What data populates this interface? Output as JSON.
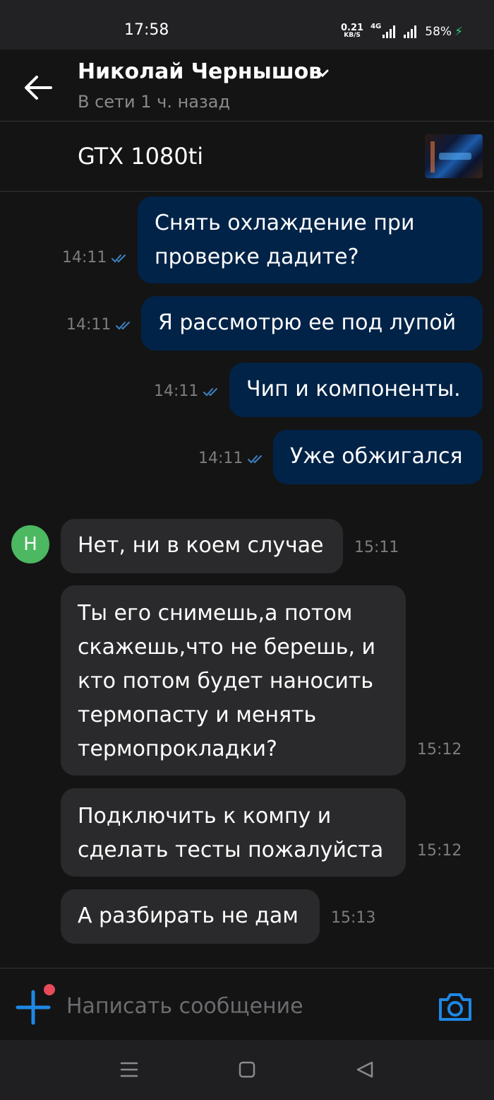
{
  "status_bar": {
    "time": "17:58",
    "speed_value": "0.21",
    "speed_unit": "KB/S",
    "network": "4G",
    "battery": "58%"
  },
  "header": {
    "contact_name": "Николай Чернышов",
    "contact_status": "В сети 1 ч. назад"
  },
  "listing": {
    "title": "GTX 1080ti"
  },
  "messages": [
    {
      "direction": "out",
      "lines": [
        "Снять охлаждение при",
        "проверке дадите?"
      ],
      "time": "14:11",
      "read": true
    },
    {
      "direction": "out",
      "lines": [
        "Я рассмотрю ее под лупой"
      ],
      "time": "14:11",
      "read": true
    },
    {
      "direction": "out",
      "lines": [
        "Чип и компоненты."
      ],
      "time": "14:11",
      "read": true
    },
    {
      "direction": "out",
      "lines": [
        "Уже обжигался"
      ],
      "time": "14:11",
      "read": true
    },
    {
      "direction": "in",
      "lines": [
        "Нет, ни в коем случае"
      ],
      "time": "15:11"
    },
    {
      "direction": "in",
      "lines": [
        "Ты его снимешь,а потом",
        "скажешь,что не берешь, и",
        "кто потом будет наносить",
        "термопасту и менять",
        "термопрокладки?"
      ],
      "time": "15:12"
    },
    {
      "direction": "in",
      "lines": [
        "Подключить к компу и",
        "сделать тесты пожалуйста"
      ],
      "time": "15:12"
    },
    {
      "direction": "in",
      "lines": [
        "А разбирать не дам"
      ],
      "time": "15:13"
    }
  ],
  "avatar_letter": "Н",
  "composer": {
    "placeholder": "Написать сообщение"
  },
  "colors": {
    "outgoing_bubble": "#022348",
    "incoming_bubble": "#2a2a2c",
    "accent": "#1e88e5",
    "avatar": "#4cb861",
    "notification_dot": "#e84a5a"
  }
}
